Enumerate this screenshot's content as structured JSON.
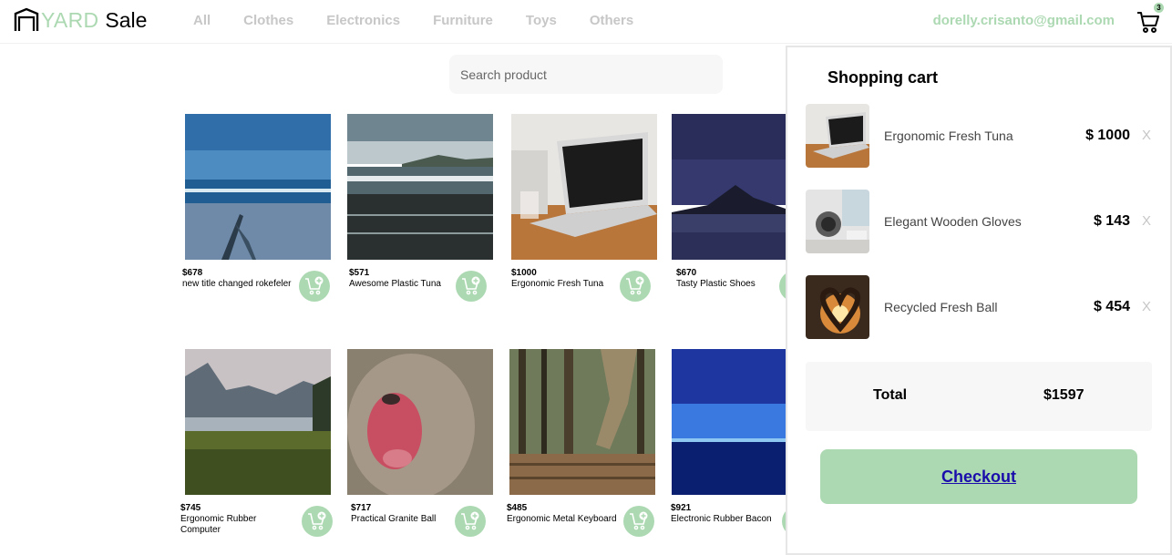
{
  "header": {
    "logo_yard": "YARD",
    "logo_sale": "Sale",
    "nav": [
      "All",
      "Clothes",
      "Electronics",
      "Furniture",
      "Toys",
      "Others"
    ],
    "user_email": "dorelly.crisanto@gmail.com",
    "cart_count": "3"
  },
  "search": {
    "placeholder": "Search product"
  },
  "products": [
    {
      "price": "$678",
      "name": "new title changed rokefeler",
      "image": "ocean-beach"
    },
    {
      "price": "$571",
      "name": "Awesome Plastic Tuna",
      "image": "sunset-beach"
    },
    {
      "price": "$1000",
      "name": "Ergonomic Fresh Tuna",
      "image": "laptop"
    },
    {
      "price": "$670",
      "name": "Tasty Plastic Shoes",
      "image": "night-mountain-lake"
    },
    {
      "price": "$745",
      "name": "Ergonomic Rubber Computer",
      "image": "lake-mountains"
    },
    {
      "price": "$717",
      "name": "Practical Granite Ball",
      "image": "monkey"
    },
    {
      "price": "$485",
      "name": "Ergonomic Metal Keyboard",
      "image": "forest-walk"
    },
    {
      "price": "$921",
      "name": "Electronic Rubber Bacon",
      "image": "blue-horizon"
    }
  ],
  "cart": {
    "title": "Shopping cart",
    "items": [
      {
        "name": "Ergonomic Fresh Tuna",
        "price": "$ 1000",
        "remove": "X",
        "image": "laptop"
      },
      {
        "name": "Elegant Wooden Gloves",
        "price": "$ 143",
        "remove": "X",
        "image": "desk-speaker"
      },
      {
        "name": "Recycled Fresh Ball",
        "price": "$ 454",
        "remove": "X",
        "image": "heart-hands"
      }
    ],
    "total_label": "Total",
    "total_value": "$1597",
    "checkout_label": "Checkout"
  },
  "colors": {
    "accent": "#acd9b2",
    "muted": "#c7c7c7",
    "panel_bg": "#f7f7f7"
  }
}
